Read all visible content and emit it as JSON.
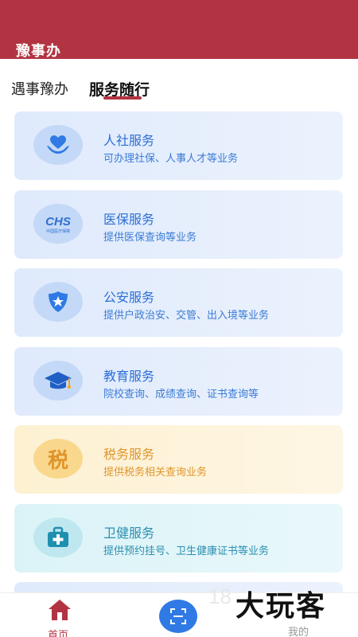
{
  "header": {
    "title": "豫事办"
  },
  "tabs": [
    {
      "label": "遇事豫办",
      "active": false
    },
    {
      "label": "服务随行",
      "active": true
    }
  ],
  "services": [
    {
      "name": "人社服务",
      "desc": "可办理社保、人事人才等业务",
      "icon": "heart-hands-icon",
      "theme": "blue"
    },
    {
      "name": "医保服务",
      "desc": "提供医保查询等业务",
      "icon": "chs-logo-icon",
      "theme": "blue",
      "logo_text": "CHS",
      "logo_subtext": "中国医疗保障"
    },
    {
      "name": "公安服务",
      "desc": "提供户政治安、交管、出入境等业务",
      "icon": "police-badge-icon",
      "theme": "blue"
    },
    {
      "name": "教育服务",
      "desc": "院校查询、成绩查询、证书查询等",
      "icon": "graduation-cap-icon",
      "theme": "blue"
    },
    {
      "name": "税务服务",
      "desc": "提供税务相关查询业务",
      "icon": "tax-icon",
      "theme": "orange",
      "icon_glyph": "税"
    },
    {
      "name": "卫健服务",
      "desc": "提供预约挂号、卫生健康证书等业务",
      "icon": "medical-kit-icon",
      "theme": "teal"
    }
  ],
  "bottom_nav": {
    "home_label": "首页",
    "mine_label": "我的"
  },
  "watermark": {
    "number": "18",
    "text": "大玩客"
  },
  "colors": {
    "brand": "#b23442",
    "accent_blue": "#2f7ae5",
    "tax_orange": "#e0952c",
    "health_teal": "#2a8fb0"
  }
}
